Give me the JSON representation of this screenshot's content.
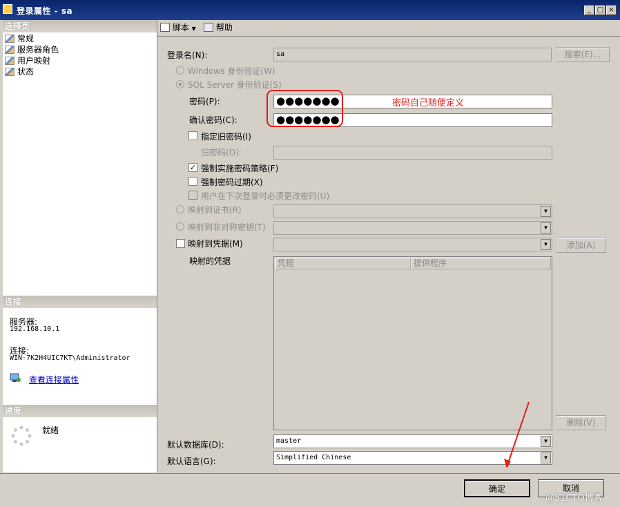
{
  "window": {
    "title": "登录属性 - sa",
    "buttons": [
      "_",
      "□",
      "×"
    ]
  },
  "left": {
    "select_page_header": "选择页",
    "pages": [
      {
        "label": "常规",
        "icon": "page-icon"
      },
      {
        "label": "服务器角色",
        "icon": "page-icon"
      },
      {
        "label": "用户映射",
        "icon": "page-icon"
      },
      {
        "label": "状态",
        "icon": "page-icon"
      }
    ],
    "connection_header": "连接",
    "server_label": "服务器:",
    "server_value": "192.168.10.1",
    "connection_label": "连接:",
    "connection_value": "WIN-7K2H4UIC7KT\\Administrator",
    "view_link": "查看连接属性",
    "progress_header": "进度",
    "progress_status": "就绪"
  },
  "toolbar": {
    "script_label": "脚本",
    "help_label": "帮助"
  },
  "form": {
    "login_name_label": "登录名(N):",
    "login_name_value": "sa",
    "search_button": "搜索(E)...",
    "windows_auth": "Windows 身份验证(W)",
    "sql_auth": "SQL Server 身份验证(S)",
    "password_label": "密码(P):",
    "password_value": "●●●●●●●",
    "confirm_label": "确认密码(C):",
    "confirm_value": "●●●●●●●",
    "annotation": "密码自己随便定义",
    "specify_old": "指定旧密码(I)",
    "old_password_label": "旧密码(O):",
    "enforce_policy": "强制实施密码策略(F)",
    "enforce_policy_checked": true,
    "enforce_expiration": "强制密码过期(X)",
    "must_change": "用户在下次登录时必须更改密码(U)",
    "map_cert": "映射到证书(R)",
    "map_asym": "映射到非对称密钥(T)",
    "map_cred": "映射到凭据(M)",
    "add_button": "添加(A)",
    "mapped_creds_label": "映射的凭据",
    "cred_columns": [
      "凭据",
      "提供程序"
    ],
    "remove_button": "删除(V)",
    "default_db_label": "默认数据库(D):",
    "default_db_value": "master",
    "default_lang_label": "默认语言(G):",
    "default_lang_value": "Simplified Chinese"
  },
  "footer": {
    "ok_button": "确定",
    "cancel_button": "取消",
    "watermark": "@51CTO博客"
  },
  "colors": {
    "annotation": "#e0201a",
    "titlebar": "#0a246a",
    "link": "#0000cc"
  }
}
